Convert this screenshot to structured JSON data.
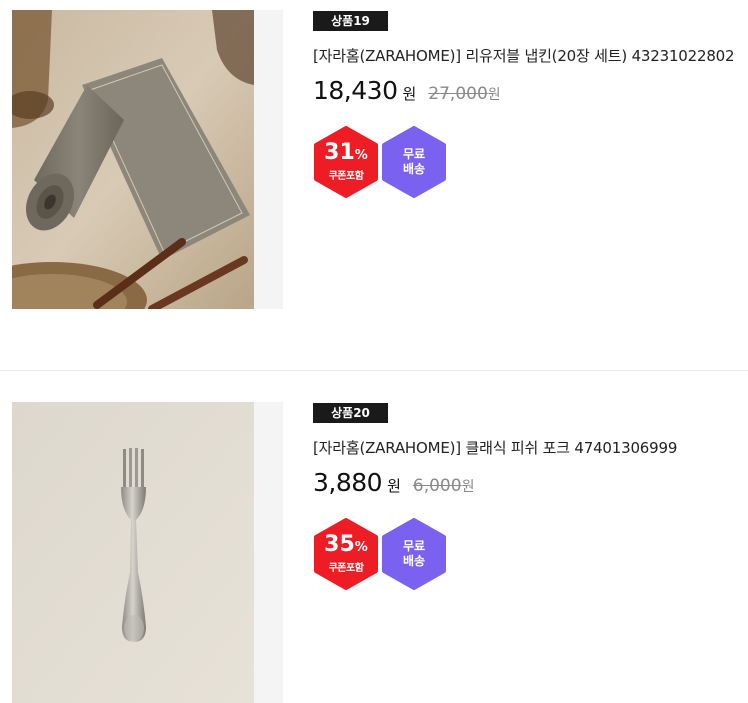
{
  "products": [
    {
      "rank": "상품19",
      "title": "[자라홈(ZARAHOME)] 리유저블 냅킨(20장 세트) 43231022802",
      "price": "18,430",
      "price_unit": "원",
      "original_price": "27,000",
      "original_unit": "원",
      "discount_value": "31",
      "discount_sign": "%",
      "coupon_label": "쿠폰포함",
      "shipping_line1": "무료",
      "shipping_line2": "배송",
      "image_subject": "rolled grey linen napkin with chopsticks"
    },
    {
      "rank": "상품20",
      "title": "[자라홈(ZARAHOME)] 클래식 피쉬 포크 47401306999",
      "price": "3,880",
      "price_unit": "원",
      "original_price": "6,000",
      "original_unit": "원",
      "discount_value": "35",
      "discount_sign": "%",
      "coupon_label": "쿠폰포함",
      "shipping_line1": "무료",
      "shipping_line2": "배송",
      "image_subject": "stainless steel fork on beige background"
    }
  ],
  "colors": {
    "rank_badge_bg": "#1a1a1a",
    "discount_hex": "#ee1c25",
    "shipping_hex": "#7b61f0",
    "original_price": "#8a8a8a"
  }
}
